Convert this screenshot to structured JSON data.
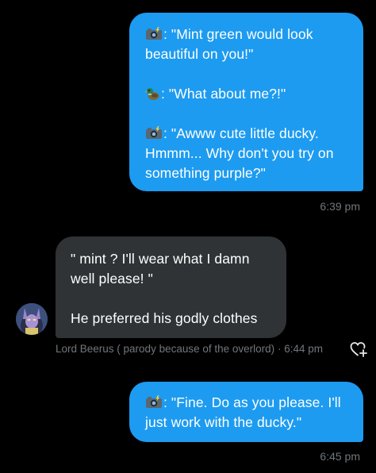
{
  "colors": {
    "background": "#000000",
    "outgoing_bubble": "#1d9bf0",
    "incoming_bubble": "#2f3336",
    "secondary_text": "#71767b"
  },
  "messages": [
    {
      "direction": "outgoing",
      "lines": [
        {
          "icon": "camera-flash-icon",
          "text": ": \"Mint green would look"
        },
        {
          "text": "beautiful on you!\""
        },
        {
          "icon": "duck-icon",
          "text": ": \"What about me?!\""
        },
        {
          "icon": "camera-flash-icon",
          "text": ": \"Awww cute little ducky."
        },
        {
          "text": "Hmmm... Why don't you try on"
        },
        {
          "text": "something purple?\""
        }
      ],
      "timestamp": "6:39 pm"
    },
    {
      "direction": "incoming",
      "lines": [
        {
          "text": "\" mint ? I'll wear what I damn"
        },
        {
          "text": "well please! \""
        },
        {
          "text": "He preferred his godly clothes"
        }
      ],
      "sender": "Lord Beerus ( parody because of the overlord)",
      "separator": "·",
      "timestamp": "6:44 pm",
      "avatar_icon": "beerus-avatar-icon",
      "reaction_icon": "heart-add-icon"
    },
    {
      "direction": "outgoing",
      "lines": [
        {
          "icon": "camera-flash-icon",
          "text": ": \"Fine. Do as you please. I'll"
        },
        {
          "text": "just work with the ducky.\""
        }
      ],
      "timestamp": "6:45 pm"
    }
  ]
}
